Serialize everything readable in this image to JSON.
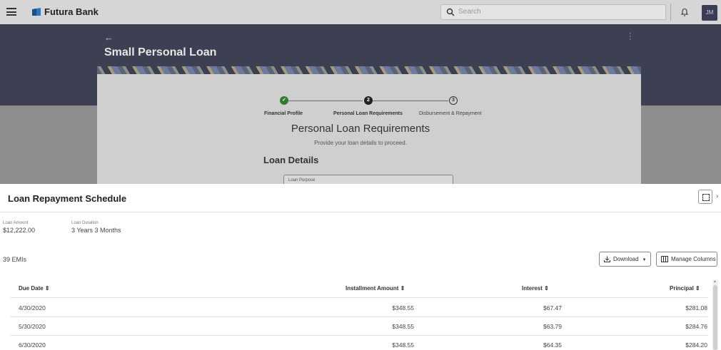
{
  "header": {
    "brand": "Futura Bank",
    "search_placeholder": "Search",
    "avatar_initials": "JM"
  },
  "page": {
    "title": "Small Personal Loan"
  },
  "stepper": {
    "steps": [
      {
        "number": "1",
        "label": "Financial Profile",
        "state": "done"
      },
      {
        "number": "2",
        "label": "Personal Loan Requirements",
        "state": "active"
      },
      {
        "number": "3",
        "label": "Disbursement & Repayment",
        "state": "pending"
      }
    ]
  },
  "form": {
    "section_title": "Personal Loan Requirements",
    "section_subtitle": "Provide your loan details to proceed.",
    "loan_details_heading": "Loan Details",
    "loan_purpose_label": "Loan Purpose"
  },
  "drawer": {
    "title": "Loan Repayment Schedule",
    "loan_amount_label": "Loan Amount",
    "loan_amount_value": "$12,222.00",
    "loan_duration_label": "Loan Duration",
    "loan_duration_value": "3 Years 3 Months",
    "emi_count": "39 EMIs",
    "download_label": "Download",
    "manage_columns_label": "Manage Columns"
  },
  "table": {
    "columns": [
      "Due Date",
      "Installment Amount",
      "Interest",
      "Principal"
    ],
    "rows": [
      [
        "4/30/2020",
        "$348.55",
        "$67.47",
        "$281.08"
      ],
      [
        "5/30/2020",
        "$348.55",
        "$63.79",
        "$284.76"
      ],
      [
        "6/30/2020",
        "$348.55",
        "$64.35",
        "$284.20"
      ]
    ]
  },
  "colors": {
    "topbar": "#d6d6d6",
    "band": "#3d4053",
    "success": "#2f7d2f",
    "avatar": "#3a3d54"
  }
}
